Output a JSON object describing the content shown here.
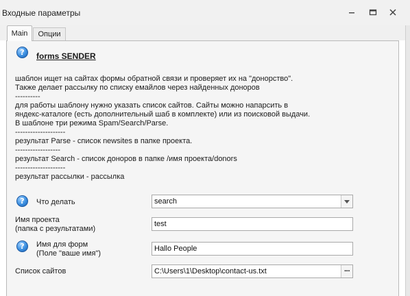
{
  "window": {
    "title": "Входные параметры"
  },
  "tabs": [
    {
      "label": "Main",
      "active": true
    },
    {
      "label": "Опции",
      "active": false
    }
  ],
  "header": {
    "help_glyph": "?",
    "title": "forms SENDER"
  },
  "description": [
    "шаблон ищет на сайтах формы обратной связи и проверяет их на \"донорство\".",
    "Также делает рассылку по списку емайлов через найденных доноров",
    "----------",
    "для работы шаблону нужно указать список сайтов. Сайты можно напарсить в",
    "яндекс-каталоге (есть дополнительный шаб в комплекте) или из поисковой выдачи.",
    "В шаблоне три режима Spam/Search/Parse.",
    "--------------------",
    "результат Parse - список newsites в папке проекта.",
    "------------------",
    "результат Search - список доноров в папке /имя проекта/donors",
    "--------------------",
    "результат рассылки - рассылка"
  ],
  "fields": {
    "action": {
      "label": "Что делать",
      "value": "search"
    },
    "project": {
      "label": "Имя проекта",
      "sublabel": "(папка с результатами)",
      "value": "test"
    },
    "form_name": {
      "label": "Имя для форм",
      "sublabel": "(Поле \"ваше имя\")",
      "value": "Hallo People"
    },
    "sites": {
      "label": "Список сайтов",
      "value": "C:\\Users\\1\\Desktop\\contact-us.txt",
      "button": "···"
    }
  },
  "colors": {
    "accent_help": "#3b8fe0",
    "panel_bg": "#f5f5f5",
    "titlebar_bg": "#f1f1f1"
  }
}
